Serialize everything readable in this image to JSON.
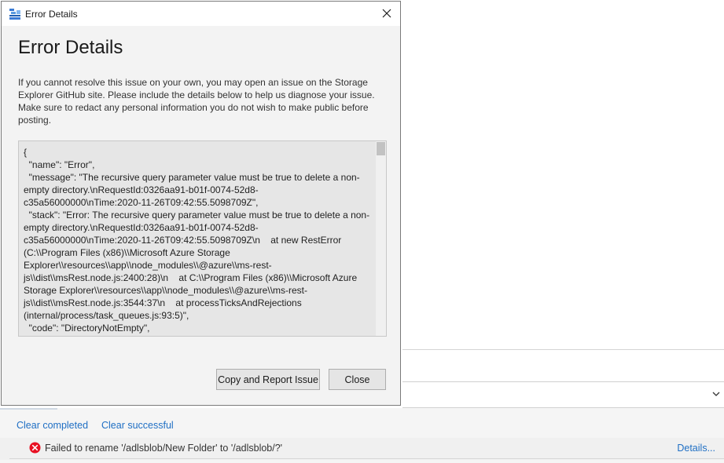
{
  "dialog": {
    "window_title": "Error Details",
    "heading": "Error Details",
    "intro": "If you cannot resolve this issue on your own, you may open an issue on the Storage Explorer GitHub site. Please include the details below to help us diagnose your issue. Make sure to redact any personal information you do not wish to make public before posting.",
    "details_text": "{\n  \"name\": \"Error\",\n  \"message\": \"The recursive query parameter value must be true to delete a non-empty directory.\\nRequestId:0326aa91-b01f-0074-52d8-c35a56000000\\nTime:2020-11-26T09:42:55.5098709Z\",\n  \"stack\": \"Error: The recursive query parameter value must be true to delete a non-empty directory.\\nRequestId:0326aa91-b01f-0074-52d8-c35a56000000\\nTime:2020-11-26T09:42:55.5098709Z\\n    at new RestError (C:\\\\Program Files (x86)\\\\Microsoft Azure Storage Explorer\\\\resources\\\\app\\\\node_modules\\\\@azure\\\\ms-rest-js\\\\dist\\\\msRest.node.js:2400:28)\\n    at C:\\\\Program Files (x86)\\\\Microsoft Azure Storage Explorer\\\\resources\\\\app\\\\node_modules\\\\@azure\\\\ms-rest-js\\\\dist\\\\msRest.node.js:3544:37\\n    at processTicksAndRejections (internal/process/task_queues.js:93:5)\",\n  \"code\": \"DirectoryNotEmpty\",",
    "copy_button": "Copy and Report Issue",
    "close_button": "Close"
  },
  "activity": {
    "clear_completed": "Clear completed",
    "clear_successful": "Clear successful",
    "message": "Failed to rename '/adlsblob/New Folder' to '/adlsblob/?'",
    "details_link": "Details..."
  },
  "icons": {
    "app": "storage-explorer-icon",
    "close": "close-icon",
    "error": "error-icon",
    "chevron": "chevron-down-icon"
  },
  "colors": {
    "link": "#1f6fc4",
    "error": "#e81123"
  }
}
